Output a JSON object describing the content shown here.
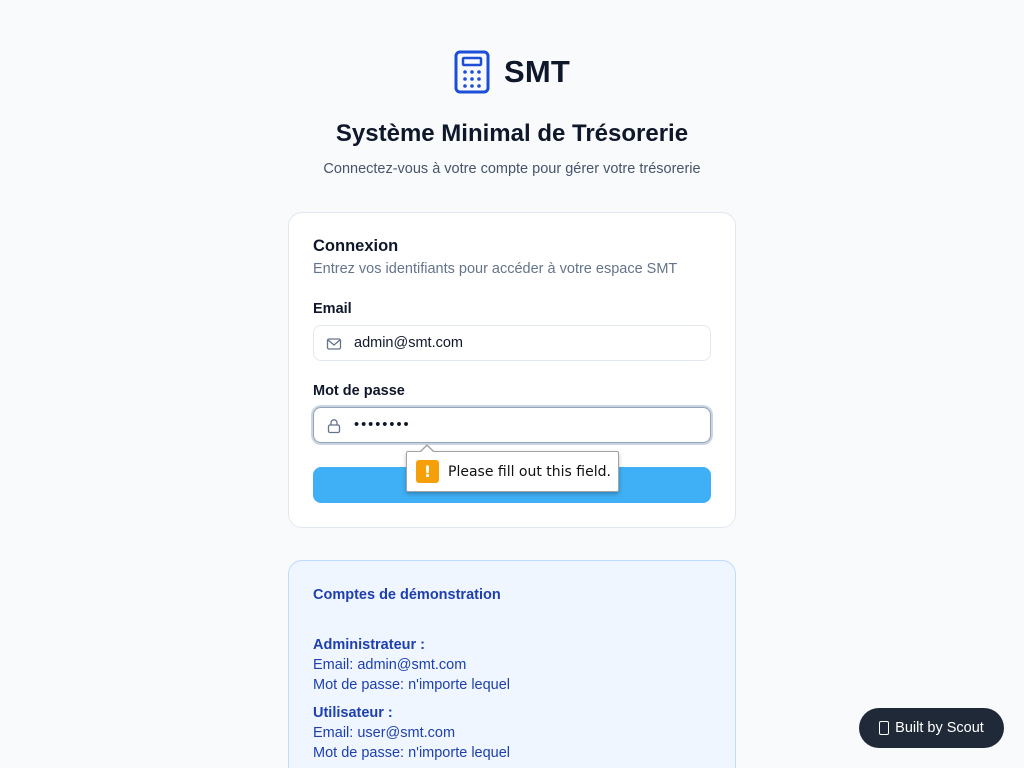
{
  "brand": {
    "name": "SMT",
    "icon": "calculator-icon",
    "accent": "#1d4ed8"
  },
  "header": {
    "title": "Système Minimal de Trésorerie",
    "subtitle": "Connectez-vous à votre compte pour gérer votre trésorerie"
  },
  "login": {
    "title": "Connexion",
    "description": "Entrez vos identifiants pour accéder à votre espace SMT",
    "email": {
      "label": "Email",
      "value": "admin@smt.com",
      "icon": "mail-icon"
    },
    "password": {
      "label": "Mot de passe",
      "value": "••••••••",
      "icon": "lock-icon"
    },
    "submit": {
      "label": "",
      "color": "#3fb0f5"
    }
  },
  "validation": {
    "message": "Please fill out this field.",
    "icon": "warning-icon",
    "color": "#f59f0b"
  },
  "demo": {
    "title": "Comptes de démonstration",
    "accounts": [
      {
        "role": "Administrateur :",
        "email": "Email: admin@smt.com",
        "password": "Mot de passe: n'importe lequel"
      },
      {
        "role": "Utilisateur :",
        "email": "Email: user@smt.com",
        "password": "Mot de passe: n'importe lequel"
      }
    ]
  },
  "badge": {
    "label": "Built by Scout",
    "icon": "scout-icon"
  }
}
